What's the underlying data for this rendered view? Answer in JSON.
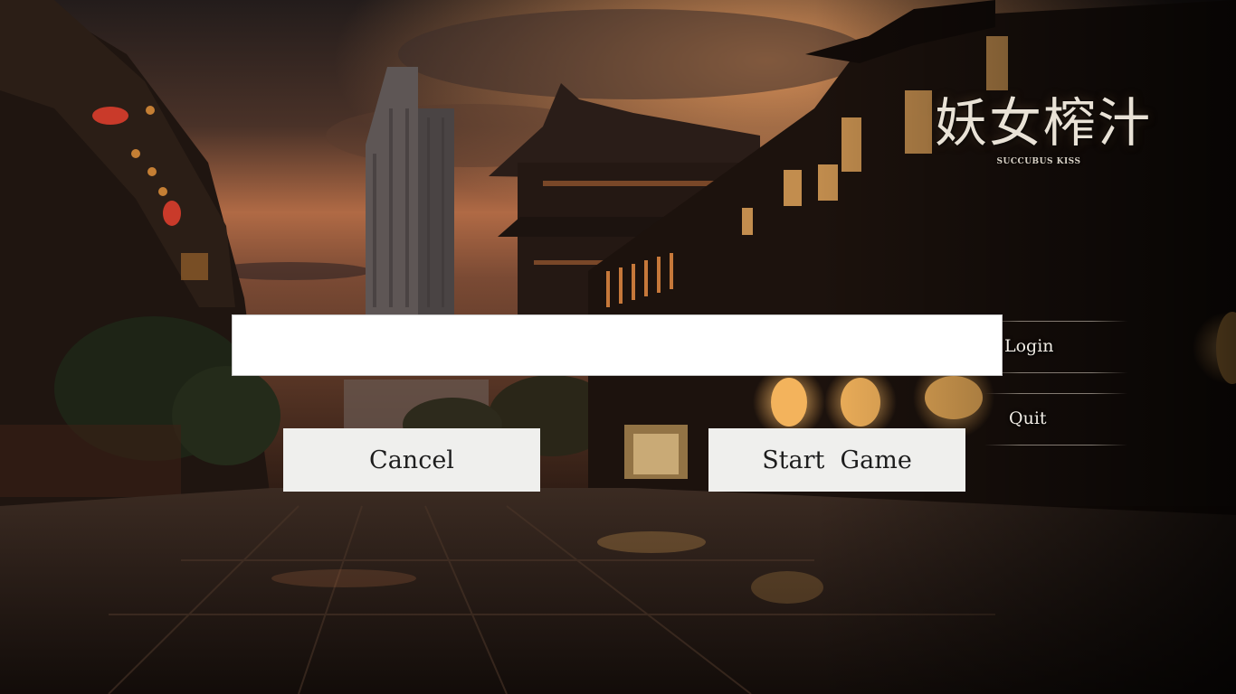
{
  "logo": {
    "title": "妖女榨汁",
    "subtitle": "SUCCUBUS KISS"
  },
  "side_menu": {
    "items": [
      {
        "label": "Login"
      },
      {
        "label": "Quit"
      }
    ]
  },
  "dialog": {
    "input_value": "",
    "cancel_label": "Cancel",
    "start_label": "Start  Game"
  },
  "colors": {
    "sky_top": "#2a2220",
    "sky_glow": "#c9794a",
    "lantern": "#f3b35c",
    "button_bg": "#efefed",
    "input_bg": "#ffffff"
  }
}
